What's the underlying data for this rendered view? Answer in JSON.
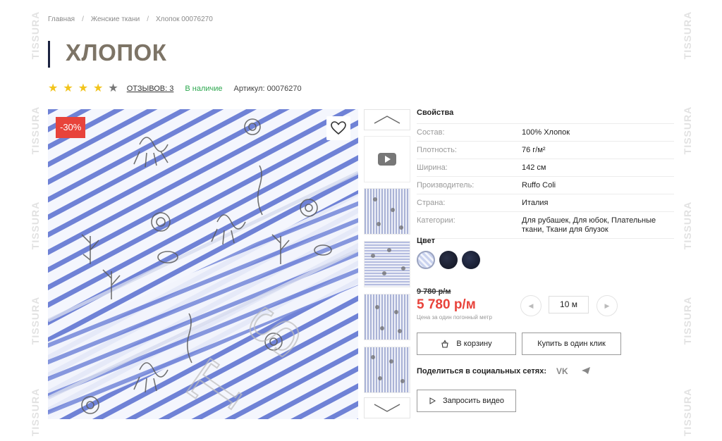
{
  "watermark": "TISSURA",
  "breadcrumb": {
    "home": "Главная",
    "section": "Женские ткани",
    "current": "Хлопок 00076270",
    "separator": "/"
  },
  "title": "ХЛОПОК",
  "rating": {
    "filled": 4,
    "total": 5
  },
  "reviews_label": "ОТЗЫВОВ: 3",
  "stock_label": "В наличие",
  "article_label": "Артикул: 00076270",
  "badge": "-30%",
  "properties": {
    "title": "Свойства",
    "rows": [
      {
        "key": "Состав:",
        "value": "100% Хлопок"
      },
      {
        "key": "Плотность:",
        "value": "76 г/м²"
      },
      {
        "key": "Ширина:",
        "value": "142 см"
      },
      {
        "key": "Производитель:",
        "value": "Ruffo Coli"
      },
      {
        "key": "Страна:",
        "value": "Италия"
      },
      {
        "key": "Категории:",
        "value": "Для рубашек, Для юбок, Плательные ткани, Ткани для блузок"
      }
    ]
  },
  "color_title": "Цвет",
  "price": {
    "old": "9 780 р/м",
    "new": "5 780 р/м",
    "note": "Цена за один погонный метр"
  },
  "quantity": "10 м",
  "buttons": {
    "cart": "В корзину",
    "one_click": "Купить в один клик",
    "request_video": "Запросить видео"
  },
  "share_label": "Поделиться в социальных сетях:",
  "colors": {
    "accent": "#e8433b",
    "stock": "#2da84f",
    "star": "#f2c41b",
    "title": "#7d7466"
  }
}
